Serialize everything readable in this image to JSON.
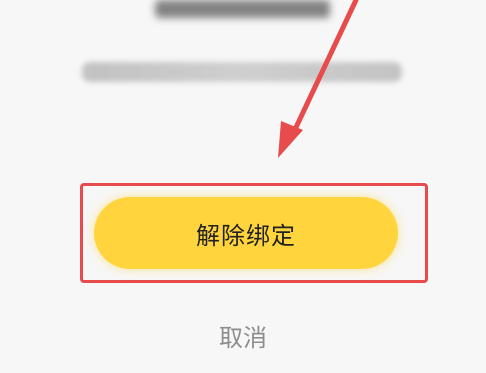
{
  "dialog": {
    "unbind_button_label": "解除绑定",
    "cancel_label": "取消"
  },
  "annotation": {
    "arrow_color": "#e74b4b",
    "highlight_color": "#e74b4b"
  },
  "colors": {
    "primary_button": "#ffd43d",
    "background": "#f7f7f7",
    "cancel_text": "#8d8d8d"
  }
}
